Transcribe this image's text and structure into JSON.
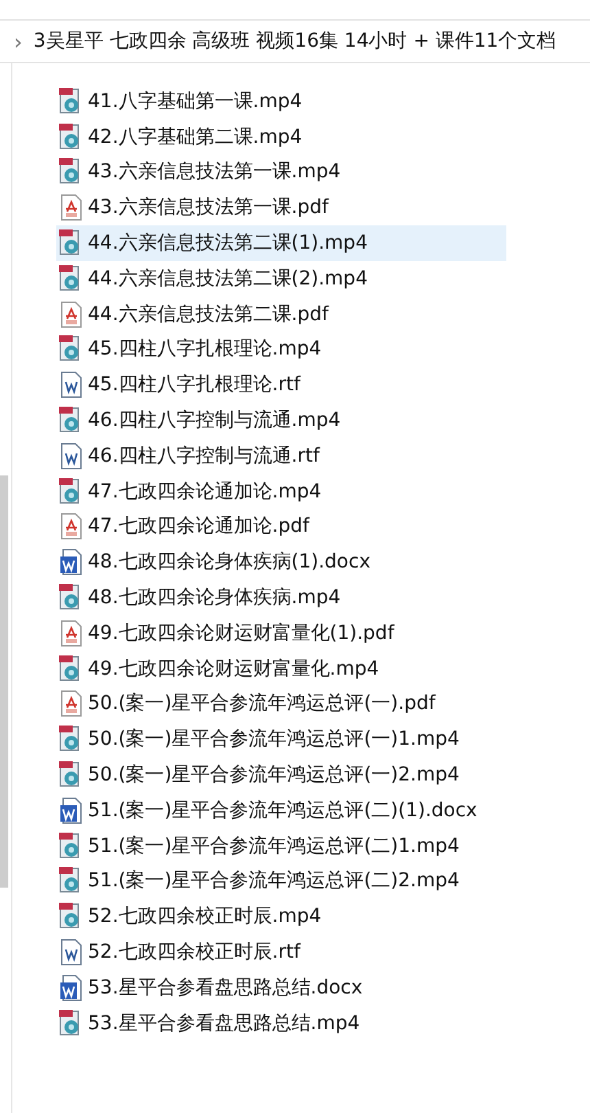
{
  "address_bar": {
    "separator": "›",
    "path": "3吴星平 七政四余 高级班 视频16集 14小时 + 课件11个文档"
  },
  "files": [
    {
      "name": "41.八字基础第一课.mp4",
      "kind": "video",
      "selected": false
    },
    {
      "name": "42.八字基础第二课.mp4",
      "kind": "video",
      "selected": false
    },
    {
      "name": "43.六亲信息技法第一课.mp4",
      "kind": "video",
      "selected": false
    },
    {
      "name": "43.六亲信息技法第一课.pdf",
      "kind": "pdf",
      "selected": false
    },
    {
      "name": "44.六亲信息技法第二课(1).mp4",
      "kind": "video",
      "selected": true
    },
    {
      "name": "44.六亲信息技法第二课(2).mp4",
      "kind": "video",
      "selected": false
    },
    {
      "name": "44.六亲信息技法第二课.pdf",
      "kind": "pdf",
      "selected": false
    },
    {
      "name": "45.四柱八字扎根理论.mp4",
      "kind": "video",
      "selected": false
    },
    {
      "name": "45.四柱八字扎根理论.rtf",
      "kind": "rtf",
      "selected": false
    },
    {
      "name": "46.四柱八字控制与流通.mp4",
      "kind": "video",
      "selected": false
    },
    {
      "name": "46.四柱八字控制与流通.rtf",
      "kind": "rtf",
      "selected": false
    },
    {
      "name": "47.七政四余论通加论.mp4",
      "kind": "video",
      "selected": false
    },
    {
      "name": "47.七政四余论通加论.pdf",
      "kind": "pdf",
      "selected": false
    },
    {
      "name": "48.七政四余论身体疾病(1).docx",
      "kind": "docx",
      "selected": false
    },
    {
      "name": "48.七政四余论身体疾病.mp4",
      "kind": "video",
      "selected": false
    },
    {
      "name": "49.七政四余论财运财富量化(1).pdf",
      "kind": "pdf",
      "selected": false
    },
    {
      "name": "49.七政四余论财运财富量化.mp4",
      "kind": "video",
      "selected": false
    },
    {
      "name": "50.(案一)星平合参流年鸿运总评(一).pdf",
      "kind": "pdf",
      "selected": false
    },
    {
      "name": "50.(案一)星平合参流年鸿运总评(一)1.mp4",
      "kind": "video",
      "selected": false
    },
    {
      "name": "50.(案一)星平合参流年鸿运总评(一)2.mp4",
      "kind": "video",
      "selected": false
    },
    {
      "name": "51.(案一)星平合参流年鸿运总评(二)(1).docx",
      "kind": "docx",
      "selected": false
    },
    {
      "name": "51.(案一)星平合参流年鸿运总评(二)1.mp4",
      "kind": "video",
      "selected": false
    },
    {
      "name": "51.(案一)星平合参流年鸿运总评(二)2.mp4",
      "kind": "video",
      "selected": false
    },
    {
      "name": "52.七政四余校正时辰.mp4",
      "kind": "video",
      "selected": false
    },
    {
      "name": "52.七政四余校正时辰.rtf",
      "kind": "rtf",
      "selected": false
    },
    {
      "name": "53.星平合参看盘思路总结.docx",
      "kind": "docx",
      "selected": false
    },
    {
      "name": "53.星平合参看盘思路总结.mp4",
      "kind": "video",
      "selected": false
    }
  ]
}
